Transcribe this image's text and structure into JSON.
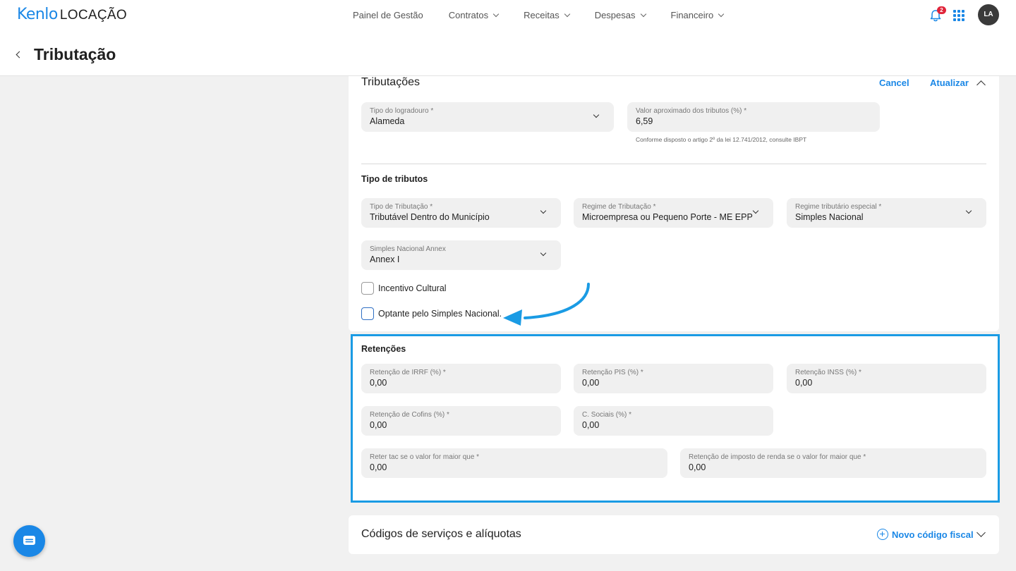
{
  "brand": {
    "name_part1": "Kenlo",
    "name_part2": "LOCAÇÃO",
    "accent": "#1a87e6"
  },
  "nav": {
    "items": [
      {
        "label": "Painel de Gestão",
        "has_dropdown": false
      },
      {
        "label": "Contratos",
        "has_dropdown": true
      },
      {
        "label": "Receitas",
        "has_dropdown": true
      },
      {
        "label": "Despesas",
        "has_dropdown": true
      },
      {
        "label": "Financeiro",
        "has_dropdown": true
      }
    ],
    "notifications_count": "2",
    "avatar_initials": "LA",
    "icons": [
      "bell-icon",
      "apps-grid-icon"
    ]
  },
  "page": {
    "title": "Tributação"
  },
  "tributacoes": {
    "title": "Tributações",
    "cancel_label": "Cancel",
    "update_label": "Atualizar",
    "tipo_logradouro": {
      "label": "Tipo do logradouro *",
      "value": "Alameda"
    },
    "valor_aproximado": {
      "label": "Valor aproximado dos tributos (%) *",
      "value": "6,59"
    },
    "hint": "Conforme disposto o artigo 2º da lei 12.741/2012, consulte IBPT"
  },
  "tipo_tributos": {
    "title": "Tipo de tributos",
    "tipo_tributacao": {
      "label": "Tipo de Tributação *",
      "value": "Tributável Dentro do Município"
    },
    "regime_tributacao": {
      "label": "Regime de Tributação *",
      "value": "Microempresa ou Pequeno Porte - ME EPP"
    },
    "regime_especial": {
      "label": "Regime tributário especial *",
      "value": "Simples Nacional"
    },
    "simples_annex": {
      "label": "Simples Nacional Annex",
      "value": "Annex I"
    },
    "incentivo_cultural": {
      "label": "Incentivo Cultural",
      "checked": false
    },
    "optante_simples": {
      "label": "Optante pelo Simples Nacional.",
      "checked": false
    }
  },
  "retencoes": {
    "title": "Retenções",
    "highlight_color": "#1a9be4",
    "irrf": {
      "label": "Retenção de IRRF (%) *",
      "value": "0,00"
    },
    "pis": {
      "label": "Retenção PIS (%) *",
      "value": "0,00"
    },
    "inss": {
      "label": "Retenção INSS (%) *",
      "value": "0,00"
    },
    "cofins": {
      "label": "Retenção de Cofins (%) *",
      "value": "0,00"
    },
    "csociais": {
      "label": "C. Sociais (%) *",
      "value": "0,00"
    },
    "reter_tac": {
      "label": "Reter tac se o valor for maior que *",
      "value": "0,00"
    },
    "retencao_ir": {
      "label": "Retenção de imposto de renda se o valor for maior que *",
      "value": "0,00"
    }
  },
  "codigos": {
    "title": "Códigos de serviços e alíquotas",
    "new_label": "Novo código fiscal"
  }
}
